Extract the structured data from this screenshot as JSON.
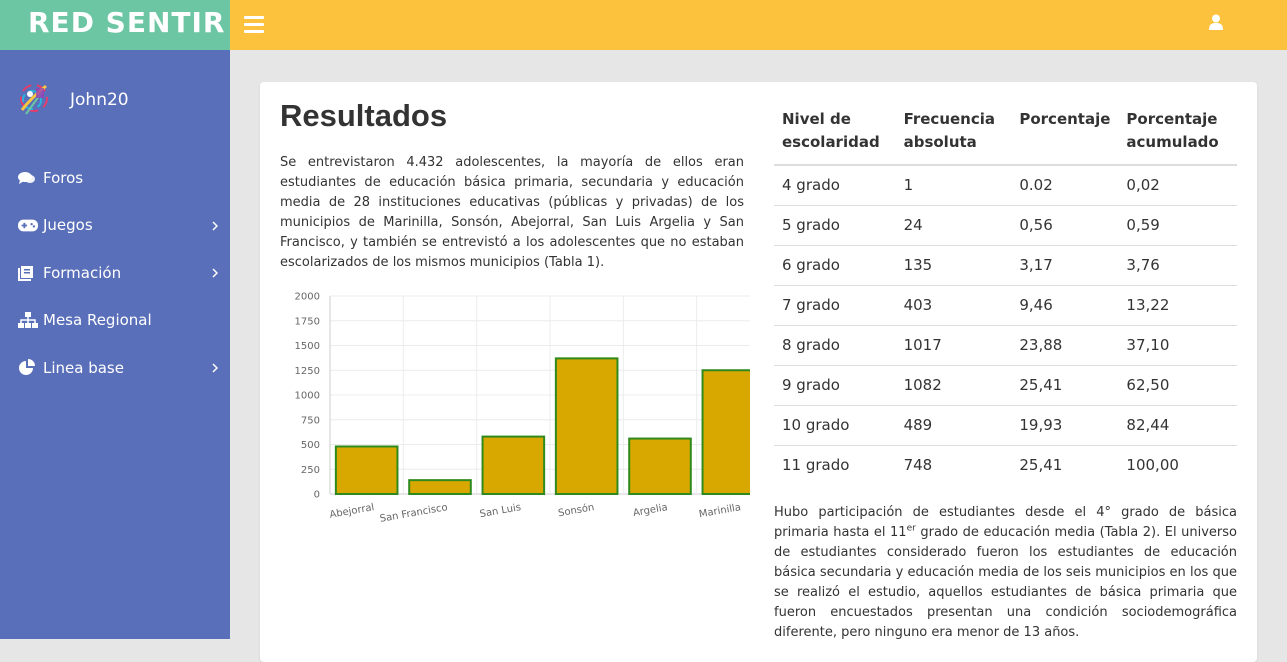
{
  "brand": {
    "name": "RED SENTIR"
  },
  "header": {
    "menu_toggle_icon": "hamburger-icon",
    "user_icon": "user-icon"
  },
  "colors": {
    "brand": "#6cc5a3",
    "topbar": "#fcc23e",
    "sidebar": "#5a6fb9",
    "bar_fill": "#d9a800",
    "bar_stroke": "#2f8a1e"
  },
  "profile": {
    "username": "John20"
  },
  "sidebar": {
    "items": [
      {
        "label": "Foros",
        "icon": "comments-icon",
        "has_submenu": false
      },
      {
        "label": "Juegos",
        "icon": "gamepad-icon",
        "has_submenu": true
      },
      {
        "label": "Formación",
        "icon": "book-icon",
        "has_submenu": true
      },
      {
        "label": "Mesa Regional",
        "icon": "sitemap-icon",
        "has_submenu": false
      },
      {
        "label": "Linea base",
        "icon": "pie-chart-icon",
        "has_submenu": true
      }
    ]
  },
  "main": {
    "title": "Resultados",
    "intro": "Se entrevistaron 4.432 adolescentes, la mayoría de ellos eran estudiantes de educación básica primaria, secundaria y educación media de 28 instituciones educativas (públicas y privadas) de los municipios de Marinilla, Sonsón, Abejorral, San Luis Argelia y San Francisco, y también se entrevistó a los adolescentes que no estaban escolarizados de los mismos municipios (Tabla 1).",
    "outro": {
      "part1": "Hubo participación de estudiantes desde el 4° grado de básica primaria hasta el 11",
      "sup": "er",
      "part2": " grado de educación media (Tabla 2). El universo de estudiantes considerado fueron los estudiantes de educación básica secundaria y educación media de los seis municipios en los que se realizó el estudio, aquellos estudiantes de básica primaria que fueron encuestados presentan una condición sociodemográfica diferente, pero ninguno era menor de 13 años."
    }
  },
  "table": {
    "headers": [
      "Nivel de escolaridad",
      "Frecuencia absoluta",
      "Porcentaje",
      "Porcentaje acumulado"
    ],
    "rows": [
      [
        "4 grado",
        "1",
        "0.02",
        "0,02"
      ],
      [
        "5 grado",
        "24",
        "0,56",
        "0,59"
      ],
      [
        "6 grado",
        "135",
        "3,17",
        "3,76"
      ],
      [
        "7 grado",
        "403",
        "9,46",
        "13,22"
      ],
      [
        "8 grado",
        "1017",
        "23,88",
        "37,10"
      ],
      [
        "9 grado",
        "1082",
        "25,41",
        "62,50"
      ],
      [
        "10 grado",
        "489",
        "19,93",
        "82,44"
      ],
      [
        "11 grado",
        "748",
        "25,41",
        "100,00"
      ]
    ]
  },
  "chart_data": {
    "type": "bar",
    "categories": [
      "Abejorral",
      "San Francisco",
      "San Luis",
      "Sonsón",
      "Argelia",
      "Marinilla"
    ],
    "values": [
      480,
      140,
      580,
      1370,
      560,
      1250
    ],
    "ylim": [
      0,
      2000
    ],
    "yticks": [
      "0",
      "250",
      "500",
      "750",
      "1000",
      "1250",
      "1500",
      "1750",
      "2000"
    ],
    "grid": true,
    "legend": "none"
  }
}
